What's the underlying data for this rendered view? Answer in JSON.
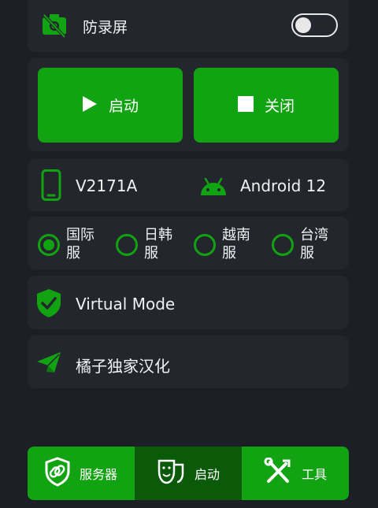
{
  "screen_protect": {
    "label": "防录屏",
    "enabled": false,
    "icon": "camera-off-icon"
  },
  "controls": {
    "start_label": "启动",
    "stop_label": "关闭",
    "start_icon": "play-icon",
    "stop_icon": "stop-icon"
  },
  "device": {
    "model": "V2171A",
    "android_version": "Android 12",
    "phone_icon": "smartphone-icon",
    "android_icon": "android-icon"
  },
  "servers": {
    "selected": "国际服",
    "items": [
      {
        "label": "国际服"
      },
      {
        "label": "日韩服"
      },
      {
        "label": "越南服"
      },
      {
        "label": "台湾服"
      }
    ]
  },
  "virtual_mode": {
    "label": "Virtual Mode",
    "icon": "shield-check-icon"
  },
  "credit": {
    "label": "橘子独家汉化",
    "icon": "paper-plane-icon"
  },
  "bottom_nav": {
    "active": "启动",
    "items": [
      {
        "label": "服务器",
        "icon": "shield-link-icon"
      },
      {
        "label": "启动",
        "icon": "masks-icon"
      },
      {
        "label": "工具",
        "icon": "tools-icon"
      }
    ]
  },
  "colors": {
    "accent": "#12a312",
    "accent_dark": "#0a5a0a",
    "background": "#1d1f26",
    "card": "#24262e",
    "text": "#f1f1f1"
  }
}
